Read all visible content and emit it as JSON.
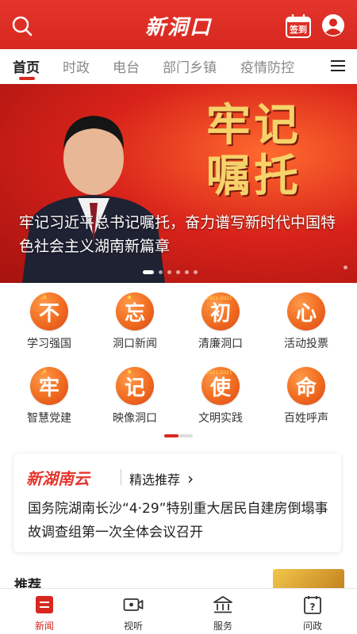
{
  "header": {
    "logo": "新洞口",
    "signin_label": "签到"
  },
  "tabs": [
    {
      "label": "首页",
      "active": true
    },
    {
      "label": "时政"
    },
    {
      "label": "电台"
    },
    {
      "label": "部门乡镇"
    },
    {
      "label": "疫情防控"
    }
  ],
  "banner": {
    "slogan_line1": "牢记",
    "slogan_line2": "嘱托",
    "caption": "牢记习近平总书记嘱托，奋力谱写新时代中国特色社会主义湖南新篇章"
  },
  "grid": [
    {
      "glyph": "不",
      "label": "学习强国",
      "emblem": "☭"
    },
    {
      "glyph": "忘",
      "label": "洞口新闻",
      "emblem": "★"
    },
    {
      "glyph": "初",
      "label": "清廉洞口",
      "emblem": "1921-2021"
    },
    {
      "glyph": "心",
      "label": "活动投票",
      "emblem": ""
    },
    {
      "glyph": "牢",
      "label": "智慧党建",
      "emblem": "☭"
    },
    {
      "glyph": "记",
      "label": "映像洞口",
      "emblem": "★"
    },
    {
      "glyph": "使",
      "label": "文明实践",
      "emblem": "1921-2021"
    },
    {
      "glyph": "命",
      "label": "百姓呼声",
      "emblem": ""
    }
  ],
  "card": {
    "brand": "新湖南云",
    "section": "精选推荐",
    "section_arrow": "›",
    "headline": "国务院湖南长沙“4·29”特别重大居民自建房倒塌事故调查组第一次全体会议召开"
  },
  "recommend": {
    "title": "推荐"
  },
  "bottom_nav": [
    {
      "label": "新闻",
      "icon": "news-icon",
      "active": true
    },
    {
      "label": "视听",
      "icon": "video-icon"
    },
    {
      "label": "服务",
      "icon": "service-icon"
    },
    {
      "label": "问政",
      "icon": "inquiry-icon"
    }
  ],
  "colors": {
    "brand_red": "#d7281f",
    "icon_orange": "#f06b1f",
    "slogan_gold": "#f6d36a"
  }
}
